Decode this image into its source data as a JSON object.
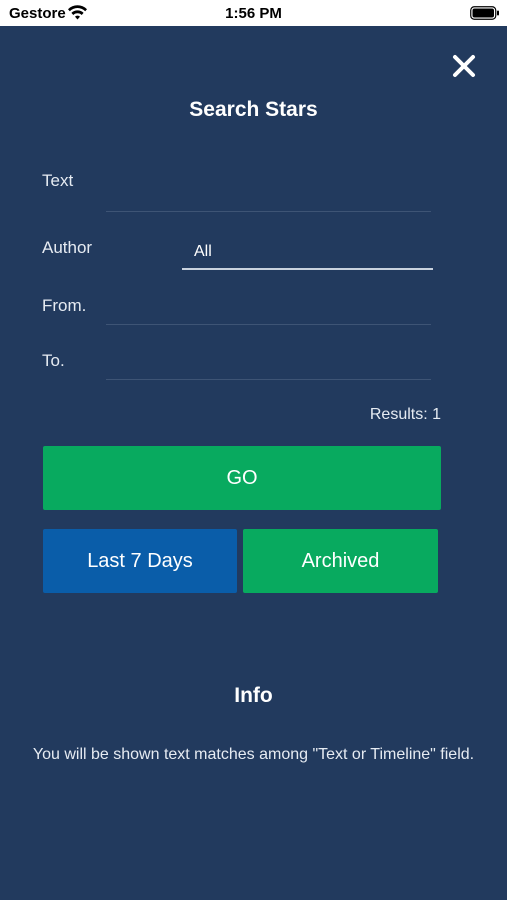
{
  "status_bar": {
    "carrier": "Gestore",
    "time": "1:56 PM",
    "wifi_icon": "wifi-icon",
    "battery_icon": "battery-full-icon"
  },
  "header": {
    "title": "Search Stars",
    "close_icon": "close-icon"
  },
  "form": {
    "text_label": "Text",
    "text_value": "",
    "author_label": "Author",
    "author_value": "All",
    "from_label": "From.",
    "from_value": "",
    "to_label": "To.",
    "to_value": ""
  },
  "results": {
    "text": "Results: 1"
  },
  "buttons": {
    "go_label": "GO",
    "last7_label": "Last 7 Days",
    "archived_label": "Archived"
  },
  "colors": {
    "background": "#223a5e",
    "go_green": "#08aa5f",
    "last7_blue": "#0a5da9"
  },
  "info": {
    "title": "Info",
    "text": "You will be shown text matches among \"Text or Timeline\" field."
  }
}
